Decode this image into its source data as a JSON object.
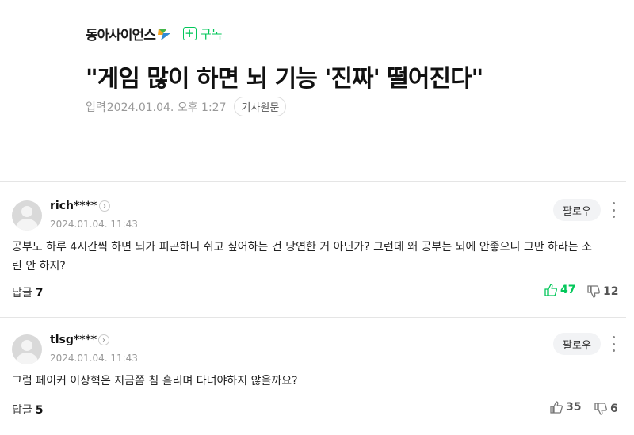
{
  "article": {
    "press_name": "동아사이언스",
    "subscribe_label": "구독",
    "headline": "\"게임 많이 하면 뇌 기능 '진짜' 떨어진다\"",
    "meta_label": "입력",
    "meta_date": "2024.01.04. 오후 1:27",
    "original_button": "기사원문"
  },
  "colors": {
    "accent": "#03c75a",
    "like_green": "#03c75a"
  },
  "comments": [
    {
      "nickname": "rich****",
      "date": "2024.01.04. 11:43",
      "follow_label": "팔로우",
      "text": "공부도 하루 4시간씩 하면 뇌가 피곤하니 쉬고 싶어하는 건 당연한 거 아닌가? 그런데 왜 공부는 뇌에 안좋으니 그만 하라는 소린 안 하지?",
      "reply_label": "답글",
      "reply_count": "7",
      "likes": "47",
      "dislikes": "12"
    },
    {
      "nickname": "tlsg****",
      "date": "2024.01.04. 11:43",
      "follow_label": "팔로우",
      "text": "그럼 페이커 이상혁은 지금쯤 침 흘리며 다녀야하지 않을까요?",
      "reply_label": "답글",
      "reply_count": "5",
      "likes": "35",
      "dislikes": "6"
    }
  ]
}
